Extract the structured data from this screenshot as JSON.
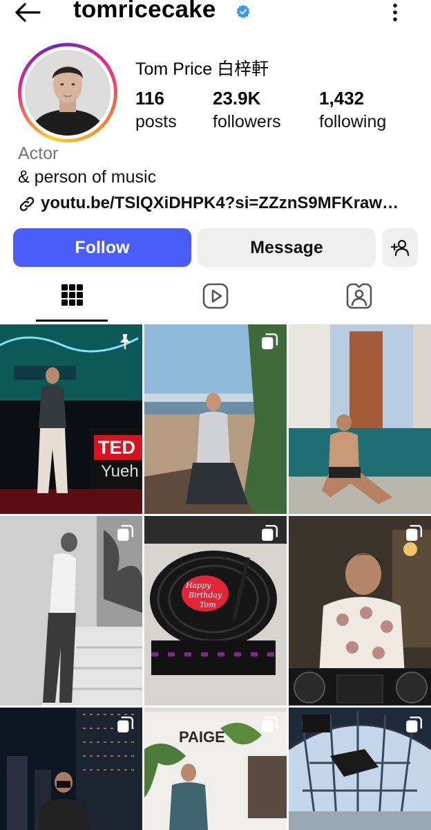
{
  "header": {
    "username": "tomricecake",
    "back_icon": "arrow-left-icon",
    "verified_icon": "verified-badge-icon",
    "menu_icon": "more-vertical-icon",
    "verified_color": "#3897f0"
  },
  "profile": {
    "full_name": "Tom Price 白梓軒",
    "stats": [
      {
        "value": "116",
        "label": "posts"
      },
      {
        "value": "23.9K",
        "label": "followers"
      },
      {
        "value": "1,432",
        "label": "following"
      }
    ],
    "category": "Actor",
    "bio": "& person of music",
    "link": "youtu.be/TSlQXiDHPK4?si=ZZznS9MFKraw…",
    "link_icon": "link-icon"
  },
  "actions": {
    "follow_label": "Follow",
    "message_label": "Message",
    "add_user_icon": "add-user-icon",
    "follow_color": "#4a5df9"
  },
  "tabs": [
    {
      "name": "posts-grid",
      "icon": "grid-icon",
      "selected": true
    },
    {
      "name": "reels",
      "icon": "reels-icon",
      "selected": false
    },
    {
      "name": "tagged",
      "icon": "tagged-icon",
      "selected": false
    }
  ],
  "posts": [
    {
      "name": "post-ted-talk",
      "badge": "pin-icon",
      "overlay_text": "TED",
      "overlay_text2": "Yueh"
    },
    {
      "name": "post-beach",
      "badge": "carousel-icon"
    },
    {
      "name": "post-pool",
      "badge": ""
    },
    {
      "name": "post-stairs-bw",
      "badge": "carousel-icon"
    },
    {
      "name": "post-birthday-cake",
      "badge": "carousel-icon",
      "cake_text": [
        "Happy",
        "Birthday",
        "Tom"
      ]
    },
    {
      "name": "post-dj",
      "badge": "carousel-icon"
    },
    {
      "name": "post-night-city",
      "badge": "carousel-icon"
    },
    {
      "name": "post-paige-store",
      "badge": "carousel-icon",
      "store_sign": "PAIGE"
    },
    {
      "name": "post-glass-dome",
      "badge": "carousel-icon"
    }
  ]
}
